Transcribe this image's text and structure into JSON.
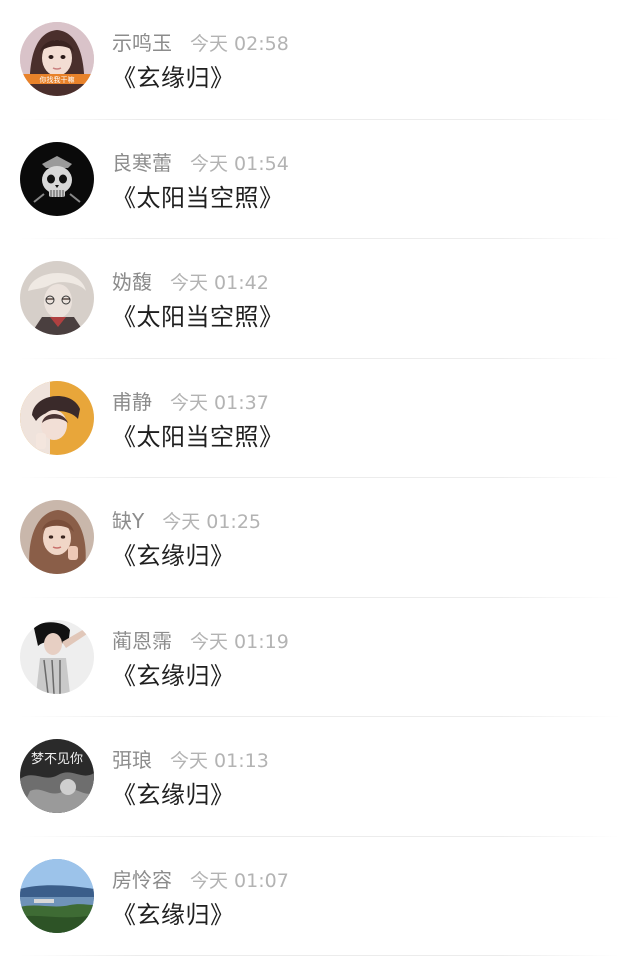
{
  "messages": [
    {
      "name": "示鸣玉",
      "time": "今天 02:58",
      "text": "《玄缘归》",
      "avatar": "girl-selfie-avatar",
      "avatar_caption": "你找我干嘛"
    },
    {
      "name": "良寒蕾",
      "time": "今天 01:54",
      "text": "《太阳当空照》",
      "avatar": "skull-avatar"
    },
    {
      "name": "妫馥",
      "time": "今天 01:42",
      "text": "《太阳当空照》",
      "avatar": "anime-boy-avatar"
    },
    {
      "name": "甫静",
      "time": "今天 01:37",
      "text": "《太阳当空照》",
      "avatar": "hooded-girl-avatar"
    },
    {
      "name": "缺Y",
      "time": "今天 01:25",
      "text": "《玄缘归》",
      "avatar": "woman-portrait-avatar"
    },
    {
      "name": "蔺恩霈",
      "time": "今天 01:19",
      "text": "《玄缘归》",
      "avatar": "woman-fashion-avatar"
    },
    {
      "name": "弭琅",
      "time": "今天 01:13",
      "text": "《玄缘归》",
      "avatar": "monochrome-art-avatar",
      "avatar_caption": "梦不见你"
    },
    {
      "name": "房怜容",
      "time": "今天 01:07",
      "text": "《玄缘归》",
      "avatar": "landscape-avatar"
    }
  ],
  "colors": {
    "name": "#8c8c8c",
    "time": "#b3b3b3",
    "message": "#1f1f1f",
    "divider": "#ececec"
  }
}
